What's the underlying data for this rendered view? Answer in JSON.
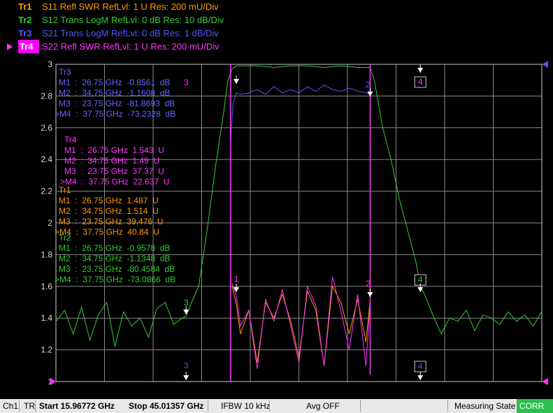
{
  "traces": [
    {
      "id": "Tr1",
      "desc": "S11 Refl SWR RefLvl: 1  U Res: 200 mU/Div",
      "color": "#ff9900",
      "selected": false
    },
    {
      "id": "Tr2",
      "desc": "S12 Trans LogM RefLvl: 0  dB Res: 10  dB/Div",
      "color": "#33cc33",
      "selected": false
    },
    {
      "id": "Tr3",
      "desc": "S21 Trans LogM RefLvl: 0  dB Res: 1  dB/Div",
      "color": "#5555ff",
      "selected": false
    },
    {
      "id": "Tr4",
      "desc": "S22 Refl SWR RefLvl: 1  U Res: 200 mU/Div",
      "color": "#ff33ff",
      "selected": true
    }
  ],
  "y_ticks": [
    "3",
    "2.8",
    "2.6",
    "2.4",
    "2.2",
    "2",
    "1.8",
    "1.6",
    "1.4",
    "1.2",
    "1"
  ],
  "marker_tables": [
    {
      "title": "Tr3",
      "color": "#6666ff",
      "rows": [
        "M1  :  26.75 GHz  -0.8561  dB",
        "M2  :  34.75 GHz  -1.1608  dB",
        "M3  :  23.75 GHz  -81.8693  dB",
        ">M4  :  37.75 GHz  -73.2328  dB"
      ]
    },
    {
      "title": "Tr4",
      "color": "#ff33ff",
      "rows": [
        "M1  :  26.75 GHz  1.543  U",
        "M2  :  34.75 GHz  1.49  U",
        "M3  :  23.75 GHz  37.37  U",
        ">M4  :  37.75 GHz  22.637  U"
      ]
    },
    {
      "title": "Tr1",
      "color": "#ff9900",
      "rows": [
        "M1  :  26.75 GHz  1.487  U",
        "M2  :  34.75 GHz  1.514  U",
        "M3  :  23.75 GHz  39.476  U",
        ">M4  :  37.75 GHz  40.84  U"
      ]
    },
    {
      "title": "Tr2",
      "color": "#33cc33",
      "rows": [
        "M1  :  26.75 GHz  -0.9578  dB",
        "M2  :  34.75 GHz  -1.1348  dB",
        "M3  :  23.75 GHz  -80.4584  dB",
        ">M4  :  37.75 GHz  -73.0866  dB"
      ]
    }
  ],
  "marker_labels": {
    "m1": "1",
    "m2": "2",
    "m3": "3",
    "m4": "4"
  },
  "status": {
    "channel": "Ch1",
    "mode": "TR",
    "start": "Start 15.96772 GHz",
    "stop": "Stop 45.01357 GHz",
    "ifbw": "IFBW 10 kHz",
    "avg": "Avg OFF",
    "state": "Measuring State",
    "corr": "CORR"
  },
  "chart_data": {
    "type": "line",
    "xlim": [
      15.96772,
      45.01357
    ],
    "ylim": [
      1,
      3
    ],
    "grid": true,
    "markers_ghz": [
      26.75,
      34.75,
      23.75,
      37.75
    ],
    "series": [
      {
        "name": "Tr2",
        "color": "#33cc33",
        "x": [
          15.97,
          16.5,
          17,
          17.5,
          18,
          18.5,
          19,
          19.5,
          20,
          20.5,
          21,
          21.5,
          22,
          22.5,
          23,
          23.5,
          23.75,
          24,
          24.5,
          25,
          25.5,
          26,
          26.25,
          26.5,
          26.75,
          27,
          28,
          29,
          30,
          31,
          32,
          33,
          34,
          34.5,
          34.75,
          35,
          35.5,
          36,
          36.5,
          37,
          37.5,
          37.75,
          38,
          38.5,
          39,
          39.5,
          40,
          40.5,
          41,
          41.5,
          42,
          42.5,
          43,
          43.5,
          44,
          44.5,
          45
        ],
        "y": [
          1.38,
          1.45,
          1.3,
          1.47,
          1.26,
          1.42,
          1.5,
          1.22,
          1.44,
          1.35,
          1.4,
          1.28,
          1.46,
          1.5,
          1.36,
          1.4,
          1.41,
          1.48,
          1.6,
          1.95,
          2.35,
          2.7,
          2.9,
          2.97,
          2.99,
          2.99,
          2.99,
          2.98,
          2.99,
          2.99,
          2.98,
          2.99,
          2.98,
          2.98,
          2.98,
          2.9,
          2.6,
          2.4,
          2.15,
          1.95,
          1.75,
          1.6,
          1.55,
          1.42,
          1.3,
          1.4,
          1.38,
          1.45,
          1.32,
          1.42,
          1.4,
          1.36,
          1.44,
          1.38,
          1.42,
          1.35,
          1.44
        ]
      },
      {
        "name": "Tr3",
        "color": "#5555ff",
        "x": [
          26.4,
          26.55,
          26.75,
          27,
          27.5,
          28,
          28.5,
          29,
          29.5,
          30,
          30.5,
          31,
          31.5,
          32,
          32.5,
          33,
          33.5,
          34,
          34.5,
          34.75
        ],
        "y": [
          2.5,
          2.75,
          2.82,
          2.81,
          2.82,
          2.84,
          2.81,
          2.86,
          2.82,
          2.84,
          2.82,
          2.86,
          2.83,
          2.87,
          2.84,
          2.83,
          2.85,
          2.83,
          2.82,
          2.81
        ]
      },
      {
        "name": "Tr1",
        "color": "#ff9900",
        "x": [
          26.5,
          26.75,
          27,
          27.5,
          28,
          28.5,
          29,
          29.5,
          30,
          30.5,
          31,
          31.5,
          32,
          32.5,
          33,
          33.5,
          34,
          34.5,
          34.75
        ],
        "y": [
          1.6,
          1.49,
          1.3,
          1.45,
          1.12,
          1.5,
          1.4,
          1.55,
          1.38,
          1.15,
          1.57,
          1.45,
          1.1,
          1.6,
          1.5,
          1.3,
          1.52,
          1.25,
          1.51
        ]
      },
      {
        "name": "Tr4",
        "color": "#ff33ff",
        "x": [
          26.5,
          26.75,
          27,
          27.5,
          28,
          28.5,
          29,
          29.5,
          30,
          30.5,
          31,
          31.5,
          32,
          32.5,
          33,
          33.5,
          34,
          34.5,
          34.75
        ],
        "y": [
          1.62,
          1.54,
          1.35,
          1.45,
          1.08,
          1.52,
          1.38,
          1.58,
          1.35,
          1.12,
          1.6,
          1.48,
          1.1,
          1.66,
          1.45,
          1.2,
          1.55,
          1.1,
          1.49
        ]
      }
    ]
  }
}
